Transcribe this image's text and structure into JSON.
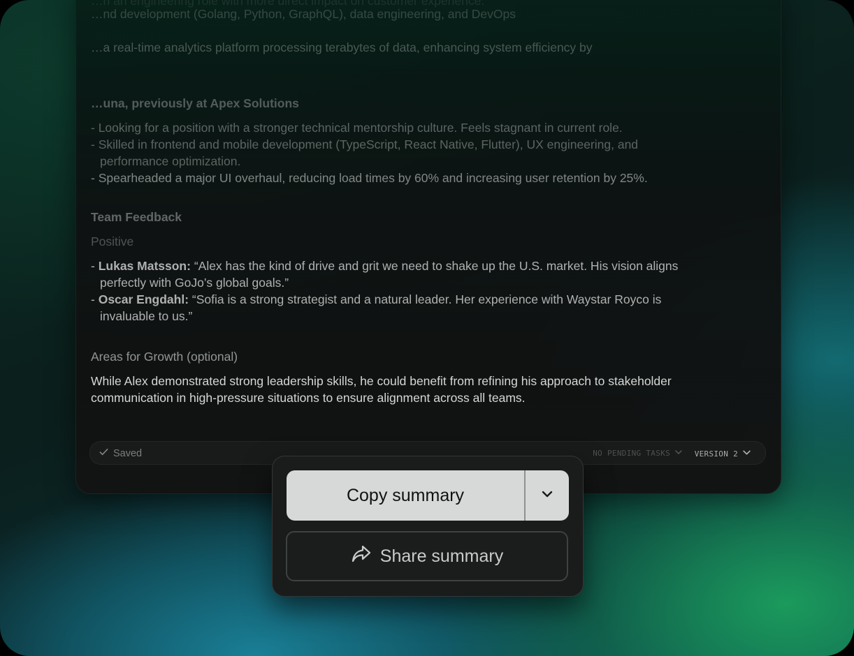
{
  "document": {
    "line1": "…h an engineering role with more direct impact on customer experience.",
    "line2": "…nd development (Golang, Python, GraphQL), data engineering, and DevOps",
    "line3": "…a real-time analytics platform processing terabytes of data, enhancing system efficiency by",
    "candidate_heading": "…una, previously at Apex Solutions",
    "candidate_points": [
      "- Looking for a position with a stronger technical mentorship culture. Feels stagnant in current role.",
      "- Skilled in frontend and mobile development (TypeScript, React Native, Flutter), UX engineering, and",
      "performance optimization.",
      "- Spearheaded a major UI overhaul, reducing load times by 60% and increasing user retention by 25%."
    ],
    "feedback_heading": "Team Feedback",
    "positive_label": "Positive",
    "feedback": [
      {
        "prefix": "- ",
        "name": "Lukas Matsson:",
        "quote": " “Alex has the kind of drive and grit we need to shake up the U.S. market. His vision aligns",
        "continuation": "perfectly with GoJo’s global goals.”"
      },
      {
        "prefix": "- ",
        "name": "Oscar Engdahl:",
        "quote": " “Sofia is a strong strategist and a natural leader. Her experience with Waystar Royco is",
        "continuation": "invaluable to us.”"
      }
    ],
    "growth_label": "Areas for Growth (optional)",
    "growth_text": [
      "While Alex demonstrated strong leadership skills, he could benefit from refining his approach to stakeholder",
      "communication in high-pressure situations to ensure alignment across all teams."
    ]
  },
  "statusbar": {
    "saved_label": "Saved",
    "pending_label": "NO PENDING TASKS",
    "version_label": "VERSION 2"
  },
  "popup": {
    "copy_label": "Copy summary",
    "share_label": "Share summary"
  },
  "icons": {
    "saved": "check-icon",
    "pending": "chevron-down-icon",
    "version": "chevron-down-icon",
    "copy_dropdown": "chevron-down-icon",
    "share": "share-arrow-icon"
  }
}
